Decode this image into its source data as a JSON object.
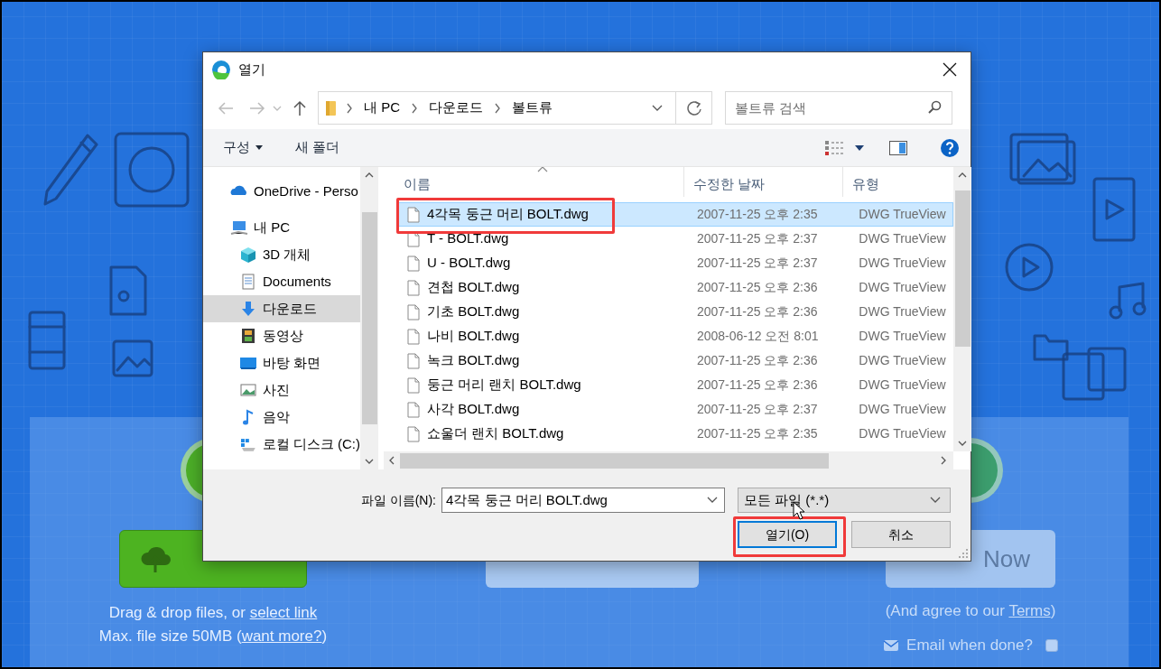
{
  "page": {
    "drop_hint": {
      "text": "Drag & drop files, or ",
      "link": "select link"
    },
    "size_hint": {
      "text": "Max. file size 50MB (",
      "link": "want more?",
      "after": ")"
    },
    "convert_now": "Now",
    "terms": {
      "text": "(And agree to our ",
      "link": "Terms",
      "after": ")"
    },
    "email": {
      "label": "Email when done?",
      "checked": false
    }
  },
  "dialog": {
    "title": "열기",
    "path": [
      "내 PC",
      "다운로드",
      "볼트류"
    ],
    "search": {
      "placeholder": "볼트류 검색"
    },
    "toolbar": [
      {
        "label": "구성",
        "menu": true
      },
      {
        "label": "새 폴더",
        "menu": false
      }
    ],
    "nav": [
      {
        "label": "OneDrive - Perso",
        "selected": false
      },
      {
        "label": "내 PC",
        "selected": false,
        "children": [
          {
            "label": "3D 개체",
            "selected": false
          },
          {
            "label": "Documents",
            "selected": false
          },
          {
            "label": "다운로드",
            "selected": true
          },
          {
            "label": "동영상",
            "selected": false
          },
          {
            "label": "바탕 화면",
            "selected": false
          },
          {
            "label": "사진",
            "selected": false
          },
          {
            "label": "음악",
            "selected": false
          },
          {
            "label": "로컬 디스크 (C:)",
            "selected": false
          }
        ]
      }
    ],
    "columns": [
      "이름",
      "수정한 날짜",
      "유형"
    ],
    "files": [
      {
        "name": "4각목 둥근 머리 BOLT.dwg",
        "date": "2007-11-25 오후 2:35",
        "type": "DWG TrueView",
        "selected": true
      },
      {
        "name": "T - BOLT.dwg",
        "date": "2007-11-25 오후 2:37",
        "type": "DWG TrueView",
        "selected": false
      },
      {
        "name": "U - BOLT.dwg",
        "date": "2007-11-25 오후 2:37",
        "type": "DWG TrueView",
        "selected": false
      },
      {
        "name": "견첩 BOLT.dwg",
        "date": "2007-11-25 오후 2:36",
        "type": "DWG TrueView",
        "selected": false
      },
      {
        "name": "기초 BOLT.dwg",
        "date": "2007-11-25 오후 2:36",
        "type": "DWG TrueView",
        "selected": false
      },
      {
        "name": "나비 BOLT.dwg",
        "date": "2008-06-12 오전 8:01",
        "type": "DWG TrueView",
        "selected": false
      },
      {
        "name": "녹크 BOLT.dwg",
        "date": "2007-11-25 오후 2:36",
        "type": "DWG TrueView",
        "selected": false
      },
      {
        "name": "둥근 머리 랜치 BOLT.dwg",
        "date": "2007-11-25 오후 2:36",
        "type": "DWG TrueView",
        "selected": false
      },
      {
        "name": "사각 BOLT.dwg",
        "date": "2007-11-25 오후 2:37",
        "type": "DWG TrueView",
        "selected": false
      },
      {
        "name": "쇼울더 랜치 BOLT.dwg",
        "date": "2007-11-25 오후 2:35",
        "type": "DWG TrueView",
        "selected": false
      }
    ],
    "filename": {
      "label": "파일 이름(N):",
      "value": "4각목 둥근 머리 BOLT.dwg"
    },
    "filter": "모든 파일 (*.*)",
    "buttons": [
      {
        "label": "열기(O)",
        "focused": true
      },
      {
        "label": "취소",
        "focused": false
      }
    ]
  }
}
